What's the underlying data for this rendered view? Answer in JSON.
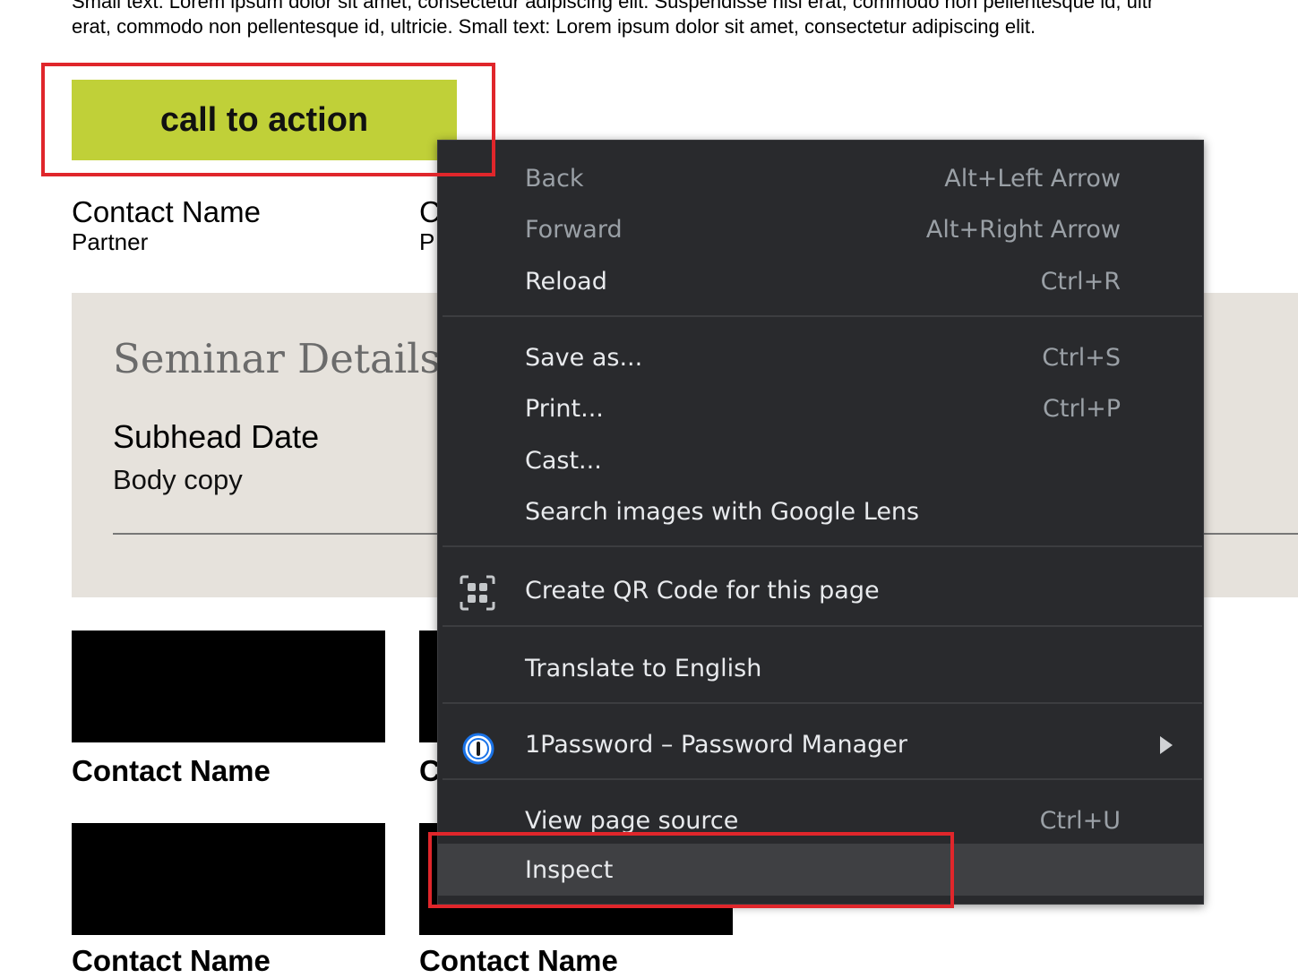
{
  "page": {
    "small_text_line1": "Small text: Lorem ipsum dolor sit amet, consectetur adipiscing elit. Suspendisse nisl erat, commodo non pellentesque id, ultr",
    "small_text_line2": "erat, commodo non pellentesque id, ultricie. Small text: Lorem ipsum dolor sit amet, consectetur adipiscing elit.",
    "cta_label": "call to action",
    "contacts_top": [
      {
        "name": "Contact Name",
        "role": "Partner"
      },
      {
        "name": "C",
        "role": "P"
      }
    ],
    "seminar": {
      "title": "Seminar Details",
      "subhead": "Subhead Date",
      "body": "Body copy"
    },
    "cards": [
      {
        "name": "Contact Name"
      },
      {
        "name": "C"
      },
      {
        "name": "Contact Name"
      },
      {
        "name": "Contact Name"
      }
    ]
  },
  "context_menu": {
    "items": [
      {
        "label": "Back",
        "shortcut": "Alt+Left Arrow",
        "enabled": false
      },
      {
        "label": "Forward",
        "shortcut": "Alt+Right Arrow",
        "enabled": false
      },
      {
        "label": "Reload",
        "shortcut": "Ctrl+R",
        "enabled": true
      },
      {
        "label": "Save as...",
        "shortcut": "Ctrl+S",
        "enabled": true
      },
      {
        "label": "Print...",
        "shortcut": "Ctrl+P",
        "enabled": true
      },
      {
        "label": "Cast...",
        "shortcut": "",
        "enabled": true
      },
      {
        "label": "Search images with Google Lens",
        "shortcut": "",
        "enabled": true
      },
      {
        "label": "Create QR Code for this page",
        "shortcut": "",
        "icon": "qr-code-icon",
        "enabled": true
      },
      {
        "label": "Translate to English",
        "shortcut": "",
        "enabled": true
      },
      {
        "label": "1Password – Password Manager",
        "shortcut": "",
        "icon": "1password-icon",
        "submenu": true,
        "enabled": true
      },
      {
        "label": "View page source",
        "shortcut": "Ctrl+U",
        "enabled": true
      },
      {
        "label": "Inspect",
        "shortcut": "",
        "enabled": true,
        "highlighted": true
      }
    ]
  },
  "colors": {
    "cta": "#c0d038",
    "menu_bg": "#292a2d",
    "annotation": "#e0262b"
  }
}
